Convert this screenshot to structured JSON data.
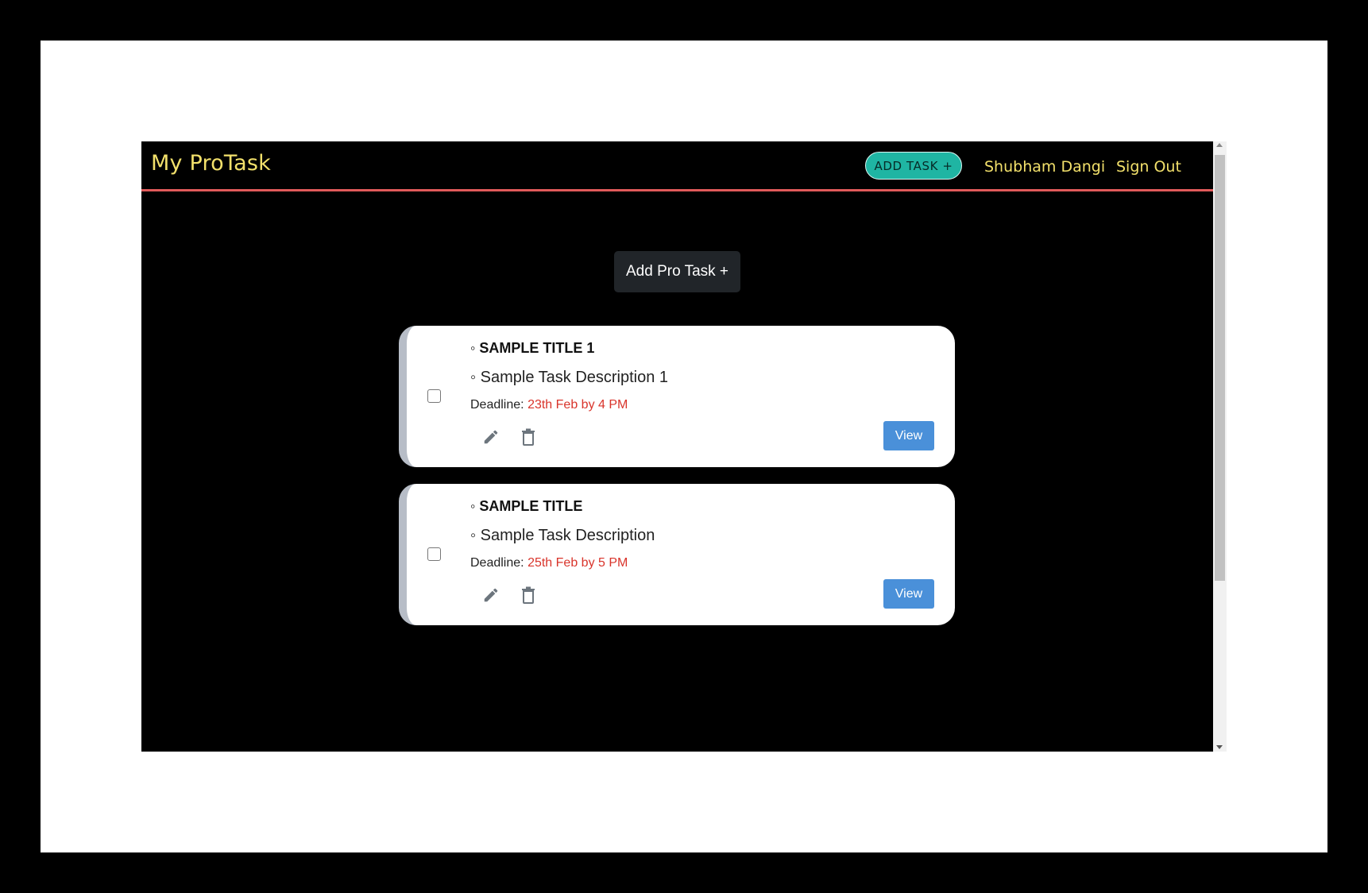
{
  "navbar": {
    "brand": "My ProTask",
    "add_task_label": "ADD TASK +",
    "user_name": "Shubham Dangi",
    "sign_out_label": "Sign Out"
  },
  "main": {
    "add_pro_task_label": "Add Pro Task +"
  },
  "tasks": [
    {
      "title": "◦ SAMPLE TITLE 1",
      "description": "◦ Sample Task Description 1",
      "deadline_label": "Deadline:",
      "deadline_value": "23th Feb by 4 PM",
      "view_label": "View"
    },
    {
      "title": "◦ SAMPLE TITLE",
      "description": "◦ Sample Task Description",
      "deadline_label": "Deadline:",
      "deadline_value": "25th Feb by 5 PM",
      "view_label": "View"
    }
  ],
  "colors": {
    "brand_text": "#f2e06b",
    "accent_teal": "#1fb5a3",
    "navbar_border": "#e05a5a",
    "deadline_red": "#d9342b",
    "view_button": "#4a90d9"
  },
  "icons": [
    "pencil-icon",
    "trash-icon"
  ]
}
